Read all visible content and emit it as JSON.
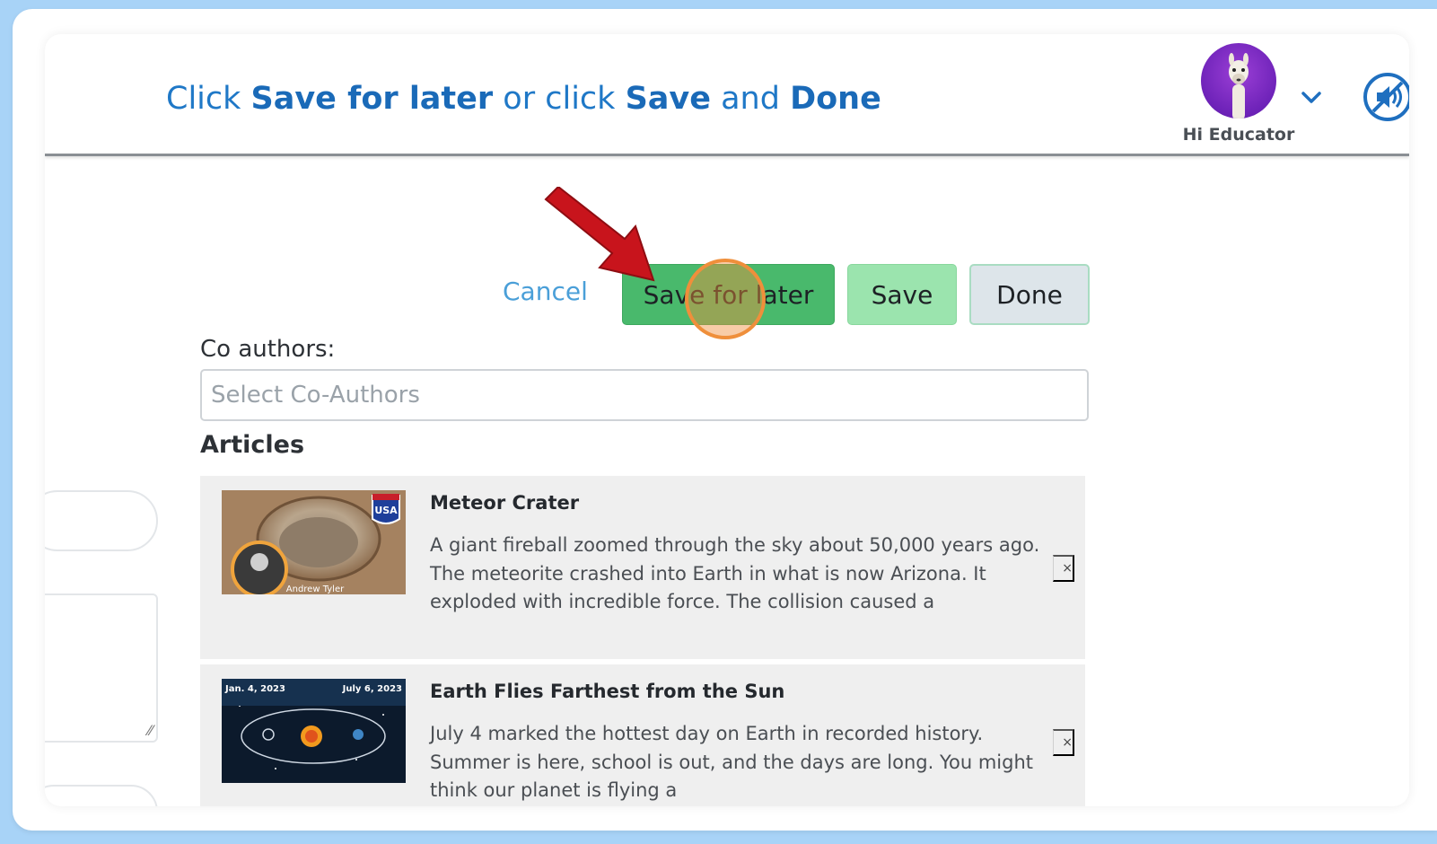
{
  "instruction": {
    "prefix": "Click ",
    "save_for_later": "Save for later",
    "middle": " or click ",
    "save": "Save",
    "and": " and ",
    "done": "Done"
  },
  "user": {
    "greeting": "Hi Educator",
    "avatar_icon": "alpaca-avatar"
  },
  "toolbar": {
    "cancel_label": "Cancel",
    "save_for_later_label": "Save for later",
    "save_label": "Save",
    "done_label": "Done"
  },
  "coauthors": {
    "label": "Co authors:",
    "placeholder": "Select Co-Authors",
    "value": ""
  },
  "articles": {
    "title": "Articles",
    "items": [
      {
        "title": "Meteor Crater",
        "summary": "A giant fireball zoomed through the sky about 50,000 years ago. The meteorite crashed into Earth in what is now Arizona. It exploded with incredible force. The collision caused a",
        "thumb_badge": "USA",
        "thumb_caption": "Andrew Tyler",
        "remove_label": "×"
      },
      {
        "title": "Earth Flies Farthest from the Sun",
        "summary": "July 4 marked the hottest day on Earth in recorded history. Summer is here, school is out, and the days are long. You might think our planet is flying a",
        "thumb_left": "Jan. 4, 2023",
        "thumb_right": "July 6, 2023",
        "remove_label": "×"
      }
    ]
  },
  "colors": {
    "page_bg": "#a8d3f7",
    "instruction_text": "#1f78c7",
    "save_for_later_bg": "#49b96c",
    "save_bg": "#9be4ae",
    "done_bg": "#dde5ea",
    "arrow": "#c8141c",
    "click_highlight": "#ef8f3b"
  }
}
